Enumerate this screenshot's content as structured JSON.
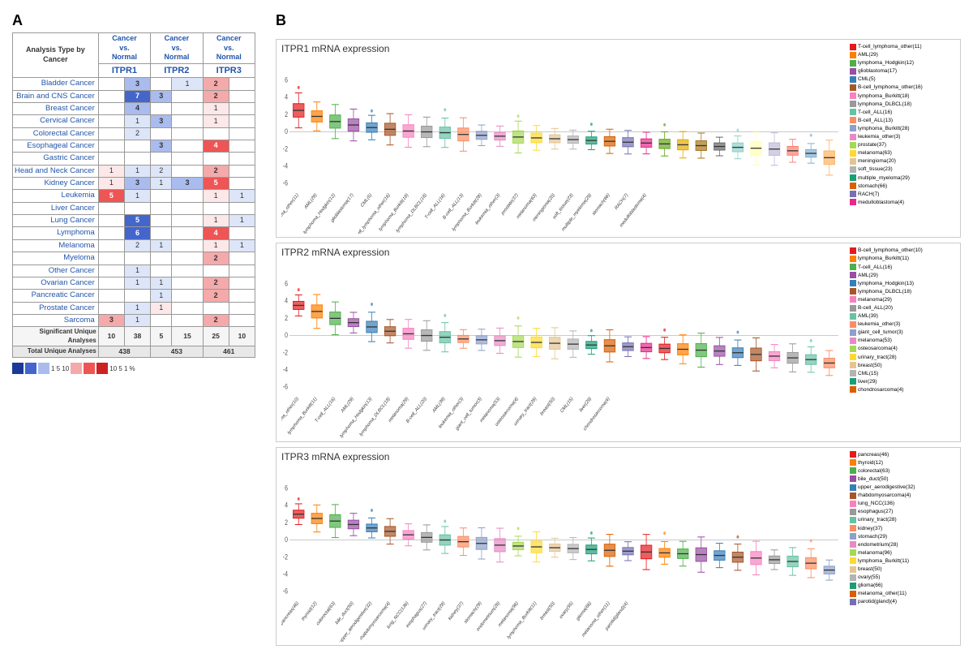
{
  "panel_a_label": "A",
  "panel_b_label": "B",
  "table": {
    "analysis_type_label": "Analysis Type by Cancer",
    "headers": [
      {
        "top": "Cancer vs. Normal",
        "gene": "ITPR1"
      },
      {
        "top": "Cancer vs. Normal",
        "gene": "ITPR2"
      },
      {
        "top": "Cancer vs. Normal",
        "gene": "ITPR3"
      }
    ],
    "rows": [
      {
        "name": "Bladder Cancer",
        "itpr1": [
          {
            "val": "",
            "cls": "cell-empty"
          },
          {
            "val": "3",
            "cls": "cell-blue-light"
          }
        ],
        "itpr2": [
          {
            "val": "",
            "cls": "cell-empty"
          },
          {
            "val": "1",
            "cls": "cell-blue-vlight"
          }
        ],
        "itpr3": [
          {
            "val": "2",
            "cls": "cell-red-light"
          },
          {
            "val": "",
            "cls": "cell-empty"
          }
        ]
      },
      {
        "name": "Brain and CNS Cancer",
        "itpr1": [
          {
            "val": "",
            "cls": "cell-empty"
          },
          {
            "val": "7",
            "cls": "cell-blue-med"
          }
        ],
        "itpr2": [
          {
            "val": "3",
            "cls": "cell-blue-light"
          },
          {
            "val": "",
            "cls": "cell-empty"
          }
        ],
        "itpr3": [
          {
            "val": "2",
            "cls": "cell-red-light"
          },
          {
            "val": "",
            "cls": "cell-empty"
          }
        ]
      },
      {
        "name": "Breast Cancer",
        "itpr1": [
          {
            "val": "",
            "cls": "cell-empty"
          },
          {
            "val": "4",
            "cls": "cell-blue-light"
          }
        ],
        "itpr2": [
          {
            "val": "",
            "cls": "cell-empty"
          },
          {
            "val": "",
            "cls": "cell-empty"
          }
        ],
        "itpr3": [
          {
            "val": "1",
            "cls": "cell-red-vlight"
          },
          {
            "val": "",
            "cls": "cell-empty"
          }
        ]
      },
      {
        "name": "Cervical Cancer",
        "itpr1": [
          {
            "val": "",
            "cls": "cell-empty"
          },
          {
            "val": "1",
            "cls": "cell-blue-vlight"
          }
        ],
        "itpr2": [
          {
            "val": "3",
            "cls": "cell-blue-light"
          },
          {
            "val": "",
            "cls": "cell-empty"
          }
        ],
        "itpr3": [
          {
            "val": "1",
            "cls": "cell-red-vlight"
          },
          {
            "val": "",
            "cls": "cell-empty"
          }
        ]
      },
      {
        "name": "Colorectal Cancer",
        "itpr1": [
          {
            "val": "",
            "cls": "cell-empty"
          },
          {
            "val": "2",
            "cls": "cell-blue-vlight"
          }
        ],
        "itpr2": [
          {
            "val": "",
            "cls": "cell-empty"
          },
          {
            "val": "",
            "cls": "cell-empty"
          }
        ],
        "itpr3": [
          {
            "val": "",
            "cls": "cell-empty"
          },
          {
            "val": "",
            "cls": "cell-empty"
          }
        ]
      },
      {
        "name": "Esophageal Cancer",
        "itpr1": [
          {
            "val": "",
            "cls": "cell-empty"
          },
          {
            "val": "",
            "cls": "cell-empty"
          }
        ],
        "itpr2": [
          {
            "val": "3",
            "cls": "cell-blue-light"
          },
          {
            "val": "",
            "cls": "cell-empty"
          }
        ],
        "itpr3": [
          {
            "val": "4",
            "cls": "cell-red-med"
          },
          {
            "val": "",
            "cls": "cell-empty"
          }
        ]
      },
      {
        "name": "Gastric Cancer",
        "itpr1": [
          {
            "val": "",
            "cls": "cell-empty"
          },
          {
            "val": "",
            "cls": "cell-empty"
          }
        ],
        "itpr2": [
          {
            "val": "",
            "cls": "cell-empty"
          },
          {
            "val": "",
            "cls": "cell-empty"
          }
        ],
        "itpr3": [
          {
            "val": "",
            "cls": "cell-empty"
          },
          {
            "val": "",
            "cls": "cell-empty"
          }
        ]
      },
      {
        "name": "Head and Neck Cancer",
        "itpr1": [
          {
            "val": "1",
            "cls": "cell-red-vlight"
          },
          {
            "val": "1",
            "cls": "cell-blue-vlight"
          }
        ],
        "itpr2": [
          {
            "val": "2",
            "cls": "cell-blue-vlight"
          },
          {
            "val": "",
            "cls": "cell-empty"
          }
        ],
        "itpr3": [
          {
            "val": "2",
            "cls": "cell-red-light"
          },
          {
            "val": "",
            "cls": "cell-empty"
          }
        ]
      },
      {
        "name": "Kidney Cancer",
        "itpr1": [
          {
            "val": "1",
            "cls": "cell-red-vlight"
          },
          {
            "val": "3",
            "cls": "cell-blue-light"
          }
        ],
        "itpr2": [
          {
            "val": "1",
            "cls": "cell-blue-vlight"
          },
          {
            "val": "3",
            "cls": "cell-blue-light"
          }
        ],
        "itpr3": [
          {
            "val": "5",
            "cls": "cell-red-med"
          },
          {
            "val": "",
            "cls": "cell-empty"
          }
        ]
      },
      {
        "name": "Leukemia",
        "itpr1": [
          {
            "val": "5",
            "cls": "cell-red-med"
          },
          {
            "val": "1",
            "cls": "cell-blue-vlight"
          }
        ],
        "itpr2": [
          {
            "val": "",
            "cls": "cell-empty"
          },
          {
            "val": "",
            "cls": "cell-empty"
          }
        ],
        "itpr3": [
          {
            "val": "1",
            "cls": "cell-red-vlight"
          },
          {
            "val": "1",
            "cls": "cell-blue-vlight"
          }
        ]
      },
      {
        "name": "Liver Cancer",
        "itpr1": [
          {
            "val": "",
            "cls": "cell-empty"
          },
          {
            "val": "",
            "cls": "cell-empty"
          }
        ],
        "itpr2": [
          {
            "val": "",
            "cls": "cell-empty"
          },
          {
            "val": "",
            "cls": "cell-empty"
          }
        ],
        "itpr3": [
          {
            "val": "",
            "cls": "cell-empty"
          },
          {
            "val": "",
            "cls": "cell-empty"
          }
        ]
      },
      {
        "name": "Lung Cancer",
        "itpr1": [
          {
            "val": "",
            "cls": "cell-empty"
          },
          {
            "val": "5",
            "cls": "cell-blue-med"
          }
        ],
        "itpr2": [
          {
            "val": "",
            "cls": "cell-empty"
          },
          {
            "val": "",
            "cls": "cell-empty"
          }
        ],
        "itpr3": [
          {
            "val": "1",
            "cls": "cell-red-vlight"
          },
          {
            "val": "1",
            "cls": "cell-blue-vlight"
          }
        ]
      },
      {
        "name": "Lymphoma",
        "itpr1": [
          {
            "val": "",
            "cls": "cell-empty"
          },
          {
            "val": "6",
            "cls": "cell-blue-med"
          }
        ],
        "itpr2": [
          {
            "val": "",
            "cls": "cell-empty"
          },
          {
            "val": "",
            "cls": "cell-empty"
          }
        ],
        "itpr3": [
          {
            "val": "4",
            "cls": "cell-red-med"
          },
          {
            "val": "",
            "cls": "cell-empty"
          }
        ]
      },
      {
        "name": "Melanoma",
        "itpr1": [
          {
            "val": "",
            "cls": "cell-empty"
          },
          {
            "val": "2",
            "cls": "cell-blue-vlight"
          }
        ],
        "itpr2": [
          {
            "val": "1",
            "cls": "cell-blue-vlight"
          },
          {
            "val": "",
            "cls": "cell-empty"
          }
        ],
        "itpr3": [
          {
            "val": "1",
            "cls": "cell-red-vlight"
          },
          {
            "val": "1",
            "cls": "cell-blue-vlight"
          }
        ]
      },
      {
        "name": "Myeloma",
        "itpr1": [
          {
            "val": "",
            "cls": "cell-empty"
          },
          {
            "val": "",
            "cls": "cell-empty"
          }
        ],
        "itpr2": [
          {
            "val": "",
            "cls": "cell-empty"
          },
          {
            "val": "",
            "cls": "cell-empty"
          }
        ],
        "itpr3": [
          {
            "val": "2",
            "cls": "cell-red-light"
          },
          {
            "val": "",
            "cls": "cell-empty"
          }
        ]
      },
      {
        "name": "Other Cancer",
        "itpr1": [
          {
            "val": "",
            "cls": "cell-empty"
          },
          {
            "val": "1",
            "cls": "cell-blue-vlight"
          }
        ],
        "itpr2": [
          {
            "val": "",
            "cls": "cell-empty"
          },
          {
            "val": "",
            "cls": "cell-empty"
          }
        ],
        "itpr3": [
          {
            "val": "",
            "cls": "cell-empty"
          },
          {
            "val": "",
            "cls": "cell-empty"
          }
        ]
      },
      {
        "name": "Ovarian Cancer",
        "itpr1": [
          {
            "val": "",
            "cls": "cell-empty"
          },
          {
            "val": "1",
            "cls": "cell-blue-vlight"
          }
        ],
        "itpr2": [
          {
            "val": "1",
            "cls": "cell-blue-vlight"
          },
          {
            "val": "",
            "cls": "cell-empty"
          }
        ],
        "itpr3": [
          {
            "val": "2",
            "cls": "cell-red-light"
          },
          {
            "val": "",
            "cls": "cell-empty"
          }
        ]
      },
      {
        "name": "Pancreatic Cancer",
        "itpr1": [
          {
            "val": "",
            "cls": "cell-empty"
          },
          {
            "val": "",
            "cls": "cell-empty"
          }
        ],
        "itpr2": [
          {
            "val": "1",
            "cls": "cell-blue-vlight"
          },
          {
            "val": "",
            "cls": "cell-empty"
          }
        ],
        "itpr3": [
          {
            "val": "2",
            "cls": "cell-red-light"
          },
          {
            "val": "",
            "cls": "cell-empty"
          }
        ]
      },
      {
        "name": "Prostate Cancer",
        "itpr1": [
          {
            "val": "",
            "cls": "cell-empty"
          },
          {
            "val": "1",
            "cls": "cell-blue-vlight"
          }
        ],
        "itpr2": [
          {
            "val": "1",
            "cls": "cell-red-vlight"
          },
          {
            "val": "",
            "cls": "cell-empty"
          }
        ],
        "itpr3": [
          {
            "val": "",
            "cls": "cell-empty"
          },
          {
            "val": "",
            "cls": "cell-empty"
          }
        ]
      },
      {
        "name": "Sarcoma",
        "itpr1": [
          {
            "val": "3",
            "cls": "cell-red-light"
          },
          {
            "val": "1",
            "cls": "cell-blue-vlight"
          }
        ],
        "itpr2": [
          {
            "val": "",
            "cls": "cell-empty"
          },
          {
            "val": "",
            "cls": "cell-empty"
          }
        ],
        "itpr3": [
          {
            "val": "2",
            "cls": "cell-red-light"
          },
          {
            "val": "",
            "cls": "cell-empty"
          }
        ]
      }
    ],
    "footer": {
      "sig_label": "Significant Unique Analyses",
      "itpr1_sig": [
        "10",
        "38"
      ],
      "itpr2_sig": [
        "5",
        "15"
      ],
      "itpr3_sig": [
        "25",
        "10"
      ],
      "total_label": "Total Unique Analyses",
      "itpr1_total": "438",
      "itpr2_total": "453",
      "itpr3_total": "461"
    },
    "legend": [
      {
        "color": "#1a3a99",
        "label": "1"
      },
      {
        "color": "#3355bb",
        "label": "5"
      },
      {
        "color": "#6688dd",
        "label": "10"
      },
      {
        "color": "#f4aaaa",
        "label": "10"
      },
      {
        "color": "#ee6666",
        "label": "5"
      },
      {
        "color": "#cc2222",
        "label": "1"
      }
    ]
  },
  "charts": [
    {
      "title": "ITPR1 mRNA expression",
      "legend_entries": [
        {
          "color": "#d62728",
          "label": "T-cell_lymphoma_other(11)"
        },
        {
          "color": "#e8a838",
          "label": "AML(29)"
        },
        {
          "color": "#bcbd22",
          "label": "lymphoma_Hodgkin(12)"
        },
        {
          "color": "#17becf",
          "label": "glioblastoma(17)"
        },
        {
          "color": "#1f77b4",
          "label": "CML(5)"
        },
        {
          "color": "#9467bd",
          "label": "B-cell_lymphoma_other(16)"
        },
        {
          "color": "#8c564b",
          "label": "lymphoma_Burkitt(18)"
        },
        {
          "color": "#e377c2",
          "label": "lymphoma_DLBCL(18)"
        },
        {
          "color": "#7f7f7f",
          "label": "T-cell_ALL(16)"
        },
        {
          "color": "#2ca02c",
          "label": "B-cell_ALL(13)"
        },
        {
          "color": "#ff7f0e",
          "label": "lymphoma_Burkitt(28)"
        },
        {
          "color": "#aec7e8",
          "label": "leukemia_other(3)"
        },
        {
          "color": "#ffbb78",
          "label": "prostate(37)"
        },
        {
          "color": "#98df8a",
          "label": "melanoma(63)"
        },
        {
          "color": "#ff9896",
          "label": "meningioma(20)"
        },
        {
          "color": "#c5b0d5",
          "label": "soft_tissue(23)"
        },
        {
          "color": "#c49c94",
          "label": "multiple_myeloma(29)"
        },
        {
          "color": "#f7b6d2",
          "label": "stomach(66)"
        },
        {
          "color": "#dbdb8d",
          "label": "RACH(7)"
        },
        {
          "color": "#9edae5",
          "label": "medulloblastoma(4)"
        }
      ]
    },
    {
      "title": "ITPR2 mRNA expression",
      "legend_entries": [
        {
          "color": "#d62728",
          "label": "B-cell_lymphoma_other(10)"
        },
        {
          "color": "#e8a838",
          "label": "lymphoma_Burkitt(11)"
        },
        {
          "color": "#bcbd22",
          "label": "T-cell_ALL(16)"
        },
        {
          "color": "#17becf",
          "label": "AML(29)"
        },
        {
          "color": "#1f77b4",
          "label": "lymphoma_Hodgkin(13)"
        },
        {
          "color": "#9467bd",
          "label": "lymphoma_DLBCL(18)"
        },
        {
          "color": "#8c564b",
          "label": "melanoma(29)"
        },
        {
          "color": "#e377c2",
          "label": "B-cell_ALL(20)"
        },
        {
          "color": "#7f7f7f",
          "label": "AML(39)"
        },
        {
          "color": "#2ca02c",
          "label": "leukemia_other(3)"
        },
        {
          "color": "#ff7f0e",
          "label": "giant_cell_tumor(3)"
        },
        {
          "color": "#aec7e8",
          "label": "melanoma(53)"
        },
        {
          "color": "#ffbb78",
          "label": "osteosarcoma(4)"
        },
        {
          "color": "#98df8a",
          "label": "urinary_tract(28)"
        },
        {
          "color": "#ff9896",
          "label": "breast(50)"
        },
        {
          "color": "#c5b0d5",
          "label": "CML(15)"
        },
        {
          "color": "#c49c94",
          "label": "liver(29)"
        },
        {
          "color": "#f7b6d2",
          "label": "chondrosarcoma(4)"
        }
      ]
    },
    {
      "title": "ITPR3 mRNA expression",
      "legend_entries": [
        {
          "color": "#d62728",
          "label": "pancreas(46)"
        },
        {
          "color": "#e8a838",
          "label": "thyroid(12)"
        },
        {
          "color": "#bcbd22",
          "label": "colorectal(63)"
        },
        {
          "color": "#17becf",
          "label": "bile_duct(50)"
        },
        {
          "color": "#1f77b4",
          "label": "upper_aerodigestive(32)"
        },
        {
          "color": "#9467bd",
          "label": "rhabdomyosarcoma(4)"
        },
        {
          "color": "#8c564b",
          "label": "lung_NCC(136)"
        },
        {
          "color": "#e377c2",
          "label": "esophagus(27)"
        },
        {
          "color": "#7f7f7f",
          "label": "urinary_tract(28)"
        },
        {
          "color": "#2ca02c",
          "label": "kidney(37)"
        },
        {
          "color": "#ff7f0e",
          "label": "stomach(29)"
        },
        {
          "color": "#aec7e8",
          "label": "endometrium(28)"
        },
        {
          "color": "#ffbb78",
          "label": "melanoma(96)"
        },
        {
          "color": "#98df8a",
          "label": "lymphoma_Burkitt(11)"
        },
        {
          "color": "#ff9896",
          "label": "breast(50)"
        },
        {
          "color": "#c5b0d5",
          "label": "ovary(55)"
        },
        {
          "color": "#c49c94",
          "label": "glioma(66)"
        },
        {
          "color": "#f7b6d2",
          "label": "melanoma_other(11)"
        },
        {
          "color": "#dbdb8d",
          "label": "parotid(gland)(4)"
        }
      ]
    }
  ]
}
